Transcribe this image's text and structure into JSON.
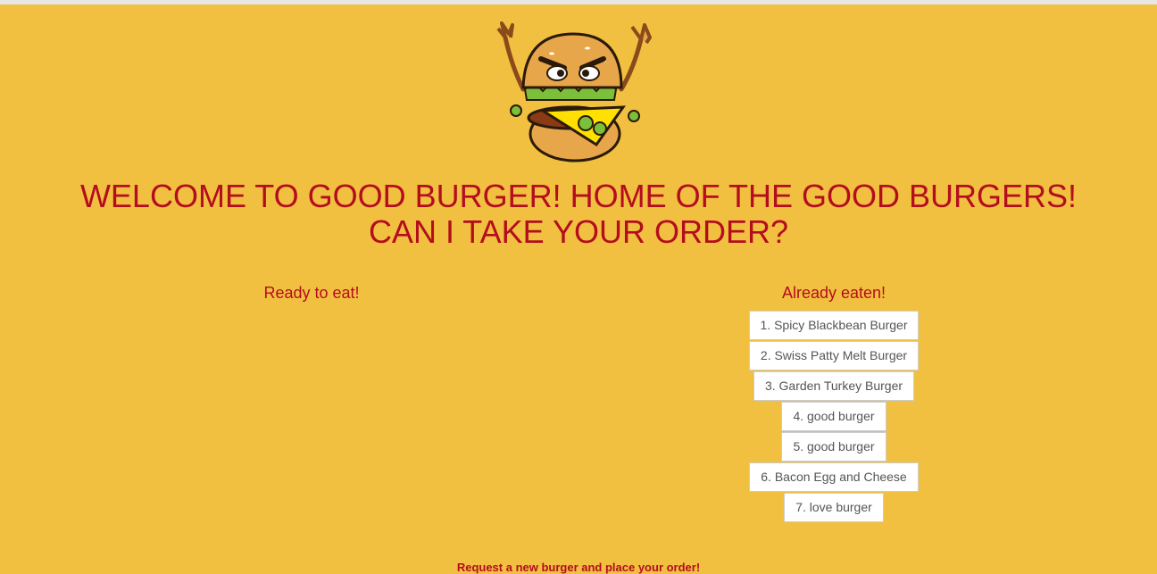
{
  "header": {
    "logo_icon": "angry-burger-mascot-icon",
    "title_line1": "WELCOME TO GOOD BURGER! HOME OF THE GOOD BURGERS!",
    "title_line2": "CAN I TAKE YOUR ORDER?"
  },
  "ready": {
    "heading": "Ready to eat!",
    "items": []
  },
  "eaten": {
    "heading": "Already eaten!",
    "items": [
      "1. Spicy Blackbean Burger",
      "2. Swiss Patty Melt Burger",
      "3. Garden Turkey Burger",
      "4. good burger",
      "5. good burger",
      "6. Bacon Egg and Cheese",
      "7. love burger"
    ]
  },
  "footer": {
    "request_text": "Request a new burger and place your order!"
  },
  "colors": {
    "background": "#f2c040",
    "accent": "#b30d1e",
    "button_bg": "#ffffff",
    "button_text": "#555555"
  }
}
